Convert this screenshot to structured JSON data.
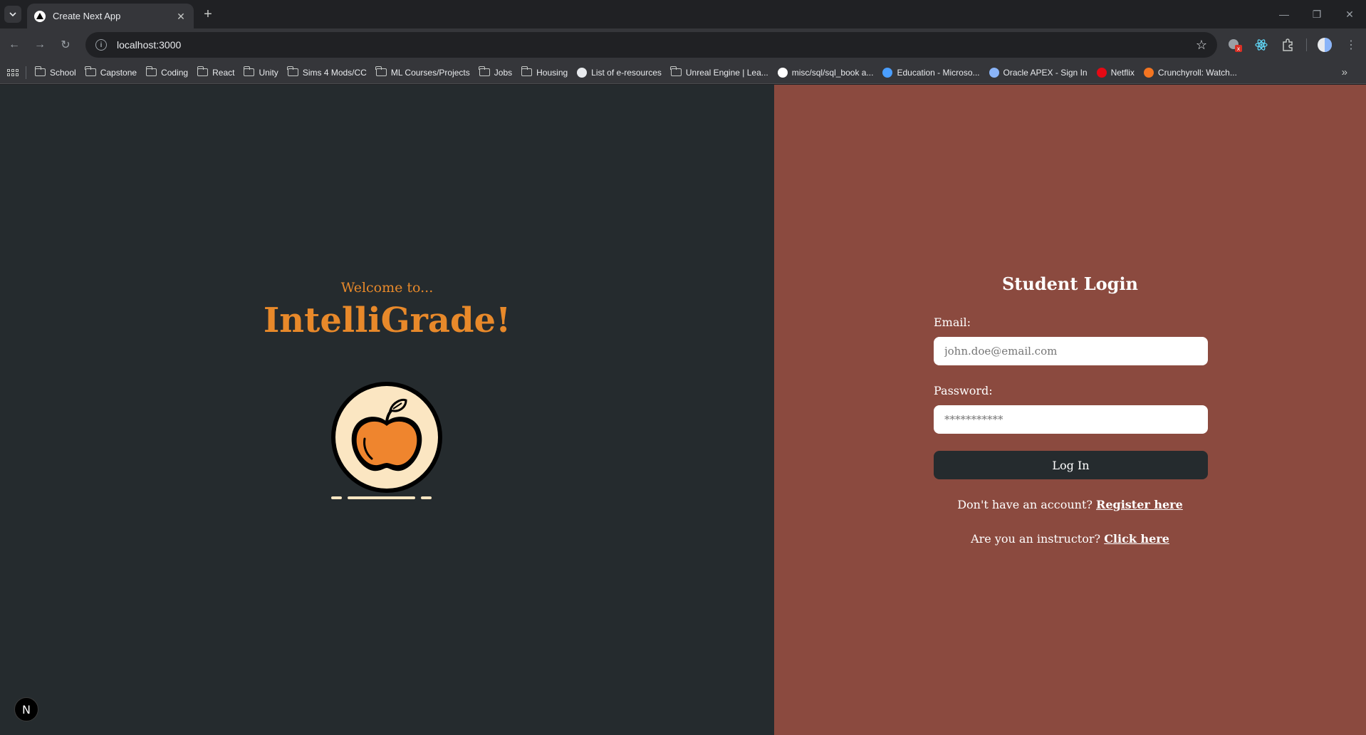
{
  "browser": {
    "tab_title": "Create Next App",
    "url": "localhost:3000",
    "bookmarks": [
      {
        "label": "School",
        "icon": "folder-icon"
      },
      {
        "label": "Capstone",
        "icon": "folder-icon"
      },
      {
        "label": "Coding",
        "icon": "folder-icon"
      },
      {
        "label": "React",
        "icon": "folder-icon"
      },
      {
        "label": "Unity",
        "icon": "folder-icon"
      },
      {
        "label": "Sims 4 Mods/CC",
        "icon": "folder-icon"
      },
      {
        "label": "ML Courses/Projects",
        "icon": "folder-icon"
      },
      {
        "label": "Jobs",
        "icon": "folder-icon"
      },
      {
        "label": "Housing",
        "icon": "folder-icon"
      },
      {
        "label": "List of e-resources",
        "icon": "site-icon",
        "color": "#e8eaed"
      },
      {
        "label": "Unreal Engine | Lea...",
        "icon": "folder-icon"
      },
      {
        "label": "misc/sql/sql_book a...",
        "icon": "github-icon",
        "color": "#ffffff"
      },
      {
        "label": "Education - Microso...",
        "icon": "azure-icon",
        "color": "#4a9eff"
      },
      {
        "label": "Oracle APEX - Sign In",
        "icon": "apex-icon",
        "color": "#8ab4f8"
      },
      {
        "label": "Netflix",
        "icon": "netflix-icon",
        "color": "#e50914"
      },
      {
        "label": "Crunchyroll: Watch...",
        "icon": "crunchyroll-icon",
        "color": "#f47521"
      }
    ]
  },
  "hero": {
    "welcome": "Welcome to...",
    "brand": "IntelliGrade!"
  },
  "login": {
    "title": "Student Login",
    "email_label": "Email:",
    "email_placeholder": "john.doe@email.com",
    "password_label": "Password:",
    "password_placeholder": "***********",
    "button": "Log In",
    "register_prompt": "Don't have an account?",
    "register_link": "Register here",
    "instructor_prompt": "Are you an instructor?",
    "instructor_link": "Click here"
  },
  "next_badge": "N",
  "colors": {
    "left_bg": "#252b2e",
    "right_bg": "#8b4a3f",
    "accent": "#e8892a",
    "logo_circle": "#fbe6c2"
  }
}
